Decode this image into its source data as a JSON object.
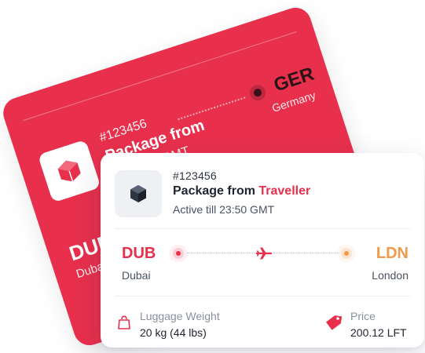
{
  "colors": {
    "primary_red": "#e8304d",
    "orange": "#f2994a",
    "text_dark": "#1f2430",
    "text_muted": "#8a909c"
  },
  "back_card": {
    "order_id": "#123456",
    "title": "Package from",
    "active_partial": "Ac   23:50 GMT",
    "from_code": "DUB",
    "from_city": "Duba",
    "to_code": "GER",
    "to_city": "Germany",
    "icon": "package-box-icon"
  },
  "front_card": {
    "order_id": "#123456",
    "title_prefix": "Package from",
    "title_accent": "Traveller",
    "active": "Active till 23:50 GMT",
    "icon": "package-box-icon",
    "route": {
      "from_code": "DUB",
      "from_city": "Dubai",
      "to_code": "LDN",
      "to_city": "London",
      "icon": "airplane-icon"
    },
    "luggage": {
      "label": "Luggage Weight",
      "value": "20 kg (44 lbs)",
      "icon": "bag-icon"
    },
    "price": {
      "label": "Price",
      "value": "200.12 LFT",
      "icon": "price-tag-icon"
    }
  }
}
